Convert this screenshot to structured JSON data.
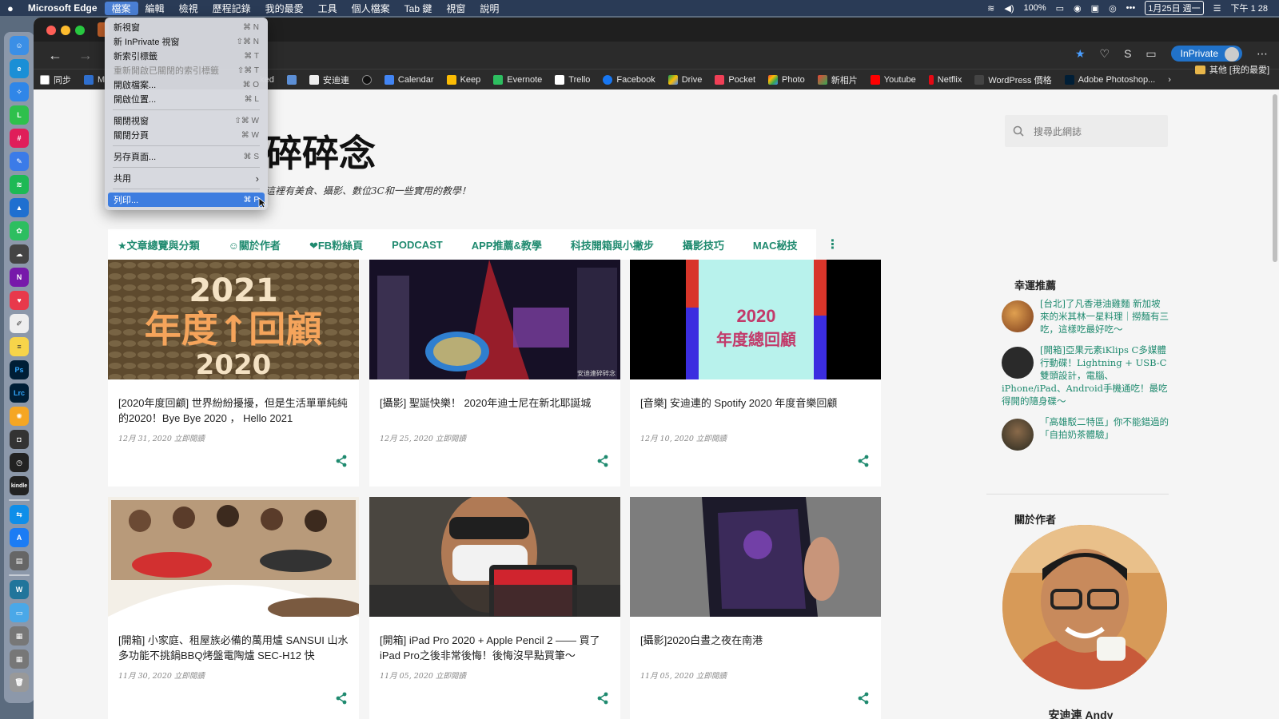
{
  "menubar": {
    "apple_icon": "apple-icon",
    "app": "Microsoft Edge",
    "items": [
      "檔案",
      "編輯",
      "檢視",
      "歷程記錄",
      "我的最愛",
      "工具",
      "個人檔案",
      "Tab 鍵",
      "視窗",
      "說明"
    ],
    "battery": "100%",
    "date": "1月25日 週一",
    "time": "下午 1 28"
  },
  "file_menu": {
    "items": [
      {
        "label": "新視窗",
        "key": "⌘ N",
        "disabled": false
      },
      {
        "label": "新 InPrivate 視窗",
        "key": "⇧⌘ N",
        "disabled": false
      },
      {
        "label": "新索引標籤",
        "key": "⌘ T",
        "disabled": false
      },
      {
        "label": "重新開啟已關閉的索引標籤",
        "key": "⇧⌘ T",
        "disabled": true
      },
      {
        "label": "開啟檔案...",
        "key": "⌘ O",
        "disabled": false
      },
      {
        "label": "開啟位置...",
        "key": "⌘ L",
        "disabled": false
      },
      {
        "label": "關閉視窗",
        "key": "⇧⌘ W",
        "disabled": false
      },
      {
        "label": "關閉分頁",
        "key": "⌘ W",
        "disabled": false
      },
      {
        "label": "另存頁面...",
        "key": "⌘ S",
        "disabled": false
      },
      {
        "label": "共用",
        "key": "›",
        "disabled": false
      },
      {
        "label": "列印...",
        "key": "⌘ P",
        "disabled": false
      }
    ]
  },
  "toolbar": {
    "inprivate_label": "InPrivate"
  },
  "bookmarks": {
    "items": [
      "同步",
      "M",
      "ked",
      "",
      "安迪連",
      "",
      "Calendar",
      "Keep",
      "Evernote",
      "Trello",
      "Facebook",
      "Drive",
      "Pocket",
      "Photo",
      "新相片",
      "Youtube",
      "Netflix",
      "WordPress 價格",
      "Adobe Photoshop..."
    ],
    "other": "其他 [我的最愛]"
  },
  "site": {
    "title_visible": "碎碎念",
    "description_visible": "這裡有美食、攝影、數位3C和一些實用的教學！",
    "search_placeholder": "搜尋此網誌",
    "nav": [
      "★文章總覽與分類",
      "☺關於作者",
      "❤FB粉絲頁",
      "PODCAST",
      "APP推薦&教學",
      "科技開箱與小撇步",
      "攝影技巧",
      "MAC秘技"
    ]
  },
  "posts": [
    {
      "title": "[2020年度回顧] 世界紛紛擾擾，但是生活單單純純的2020！Bye Bye 2020 ， Hello 2021",
      "meta": "12月 31, 2020 立即閱讀",
      "image_text": "2021 年度↑回顧 2020"
    },
    {
      "title": "[攝影] 聖誕快樂！ 2020年迪士尼在新北耶誕城",
      "meta": "12月 25, 2020 立即閱讀",
      "image_text": "安迪連碎碎念"
    },
    {
      "title": "[音樂] 安迪連的 Spotify 2020 年度音樂回顧",
      "meta": "12月 10, 2020 立即閱讀",
      "image_text_1": "2020",
      "image_text_2": "年度總回顧"
    },
    {
      "title": "[開箱] 小家庭、租屋族必備的萬用爐 SANSUI 山水 多功能不挑鍋BBQ烤盤電陶爐 SEC-H12 快",
      "meta": "11月 30, 2020 立即閱讀"
    },
    {
      "title": "[開箱] iPad Pro 2020 + Apple Pencil 2 —— 買了 iPad Pro之後非常後悔！後悔沒早點買筆～",
      "meta": "11月 05, 2020 立即閱讀"
    },
    {
      "title": "[攝影]2020白晝之夜在南港",
      "meta": "11月 05, 2020 立即閱讀"
    }
  ],
  "sidebar": {
    "lucky_heading": "幸運推薦",
    "recommendations": [
      "[台北]了凡香港油雞麵 新加坡來的米其林一星料理｜撈麵有三吃，這樣吃最好吃～",
      "[開箱]亞果元素iKlips C多媒體行動碟！Lightning + USB-C雙頭設計，電腦、iPhone/iPad、Android手機通吃！最吃得開的隨身碟～",
      "「高雄駁二特區」你不能錯過的「自拍奶茶體驗」"
    ],
    "author_heading": "關於作者",
    "author_name": "安迪連 Andy"
  },
  "colors": {
    "accent": "#1f8a6f",
    "menu_highlight": "#3d7de0",
    "inprivate": "#2172c9"
  }
}
